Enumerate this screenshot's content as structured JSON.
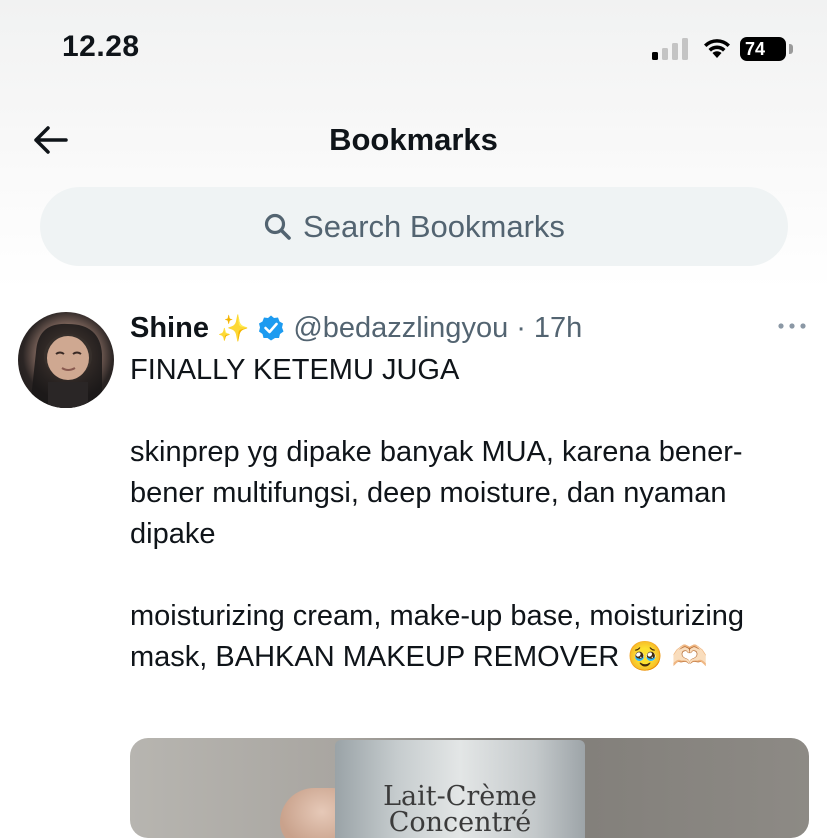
{
  "status_bar": {
    "time": "12.28",
    "battery": "74"
  },
  "header": {
    "title": "Bookmarks"
  },
  "search": {
    "placeholder": "Search Bookmarks"
  },
  "tweet": {
    "author_name": "Shine",
    "author_emoji": "✨",
    "handle": "@bedazzlingyou",
    "separator": "·",
    "time": "17h",
    "text_line_1": "FINALLY KETEMU JUGA",
    "text_line_2": "skinprep yg dipake banyak MUA, karena bener-bener multifungsi, deep moisture, dan nyaman dipake",
    "text_line_3": "moisturizing cream, make-up base, moisturizing mask, BAHKAN MAKEUP REMOVER 🥹 🫶🏻",
    "media_text_1": "Lait-Crème",
    "media_text_2": "Concentré"
  },
  "icons": {
    "back": "arrow-left-icon",
    "search": "search-icon",
    "verified": "verified-badge-icon",
    "more": "more-horizontal-icon"
  },
  "colors": {
    "text": "#0f1419",
    "secondary_text": "#536471",
    "search_bg": "#eff3f4",
    "verified_blue": "#1d9bf0"
  }
}
